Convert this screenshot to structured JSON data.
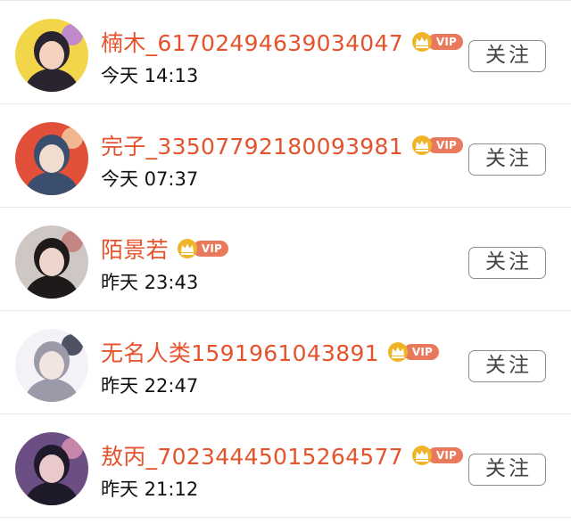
{
  "users": [
    {
      "name": "楠木_61702494639034047",
      "vip_label": "VIP",
      "time": "今天 14:13",
      "follow_label": "关注",
      "avatar": {
        "bg": "#f3d54a",
        "figure": "#2a2430",
        "face": "#f4d2bf",
        "accent": "#b57de0"
      }
    },
    {
      "name": "完子_33507792180093981",
      "vip_label": "VIP",
      "time": "今天 07:37",
      "follow_label": "关注",
      "avatar": {
        "bg": "#e3503a",
        "figure": "#3a4f6e",
        "face": "#f1dcd0",
        "accent": "#f2c9a0"
      }
    },
    {
      "name": "陌景若",
      "vip_label": "VIP",
      "time": "昨天 23:43",
      "follow_label": "关注",
      "avatar": {
        "bg": "#cfc7c4",
        "figure": "#1e1a1a",
        "face": "#efd6cc",
        "accent": "#c27a78"
      }
    },
    {
      "name": "无名人类1591961043891",
      "vip_label": "VIP",
      "time": "昨天 22:47",
      "follow_label": "关注",
      "avatar": {
        "bg": "#f4f2f6",
        "figure": "#9a9aa8",
        "face": "#f2e4e0",
        "accent": "#2f3546"
      }
    },
    {
      "name": "敖丙_70234445015264577",
      "vip_label": "VIP",
      "time": "昨天 21:12",
      "follow_label": "关注",
      "avatar": {
        "bg": "#6a4e84",
        "figure": "#1f1a2a",
        "face": "#e9c9c9",
        "accent": "#d88fb3"
      }
    }
  ],
  "colors": {
    "name": "#e5532d",
    "vip_tag": "#e8795c",
    "crown": "#f0b429",
    "divider": "#e6e6e6",
    "button_border": "#8e8e8e"
  },
  "icons": {
    "vip_badge": "crown-icon"
  }
}
